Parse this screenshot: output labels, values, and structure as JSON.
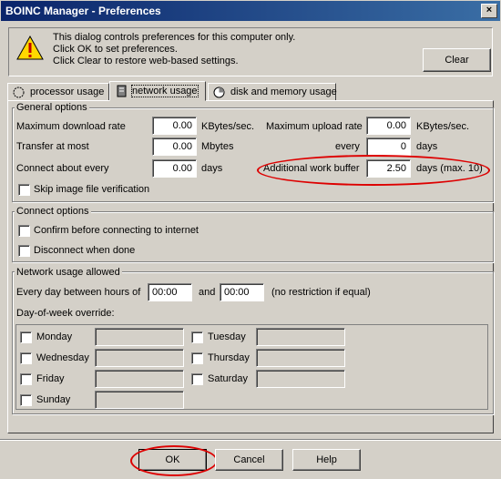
{
  "window": {
    "title": "BOINC Manager - Preferences",
    "close_glyph": "×"
  },
  "info": {
    "line1": "This dialog controls preferences for this computer only.",
    "line2": "Click OK to set preferences.",
    "line3": "Click Clear to restore web-based settings.",
    "clear_label": "Clear",
    "icon": "warning-icon"
  },
  "tabs": [
    {
      "label": "processor usage",
      "icon": "processor-icon"
    },
    {
      "label": "network usage",
      "icon": "network-icon",
      "selected": true
    },
    {
      "label": "disk and memory usage",
      "icon": "disk-icon"
    }
  ],
  "general": {
    "title": "General options",
    "max_download_label": "Maximum download rate",
    "max_download_value": "0.00",
    "max_download_unit": "KBytes/sec.",
    "max_upload_label": "Maximum upload rate",
    "max_upload_value": "0.00",
    "max_upload_unit": "KBytes/sec.",
    "transfer_label": "Transfer at most",
    "transfer_value": "0.00",
    "transfer_unit": "Mbytes",
    "every_label": "every",
    "every_value": "0",
    "every_unit": "days",
    "connect_label": "Connect about every",
    "connect_value": "0.00",
    "connect_unit": "days",
    "buffer_label": "Additional work buffer",
    "buffer_value": "2.50",
    "buffer_unit": "days (max. 10)",
    "skip_label": "Skip image file verification"
  },
  "connect": {
    "title": "Connect options",
    "confirm_label": "Confirm before connecting to internet",
    "disconnect_label": "Disconnect when done"
  },
  "network": {
    "title": "Network usage allowed",
    "every_day_label": "Every day between hours of",
    "start_value": "00:00",
    "and_label": "and",
    "end_value": "00:00",
    "no_restriction": "(no restriction if equal)",
    "override_label": "Day-of-week override:",
    "days": [
      "Monday",
      "Tuesday",
      "Wednesday",
      "Thursday",
      "Friday",
      "Saturday",
      "Sunday"
    ]
  },
  "buttons": {
    "ok": "OK",
    "cancel": "Cancel",
    "help": "Help"
  },
  "annotation_color": "#dd0000"
}
